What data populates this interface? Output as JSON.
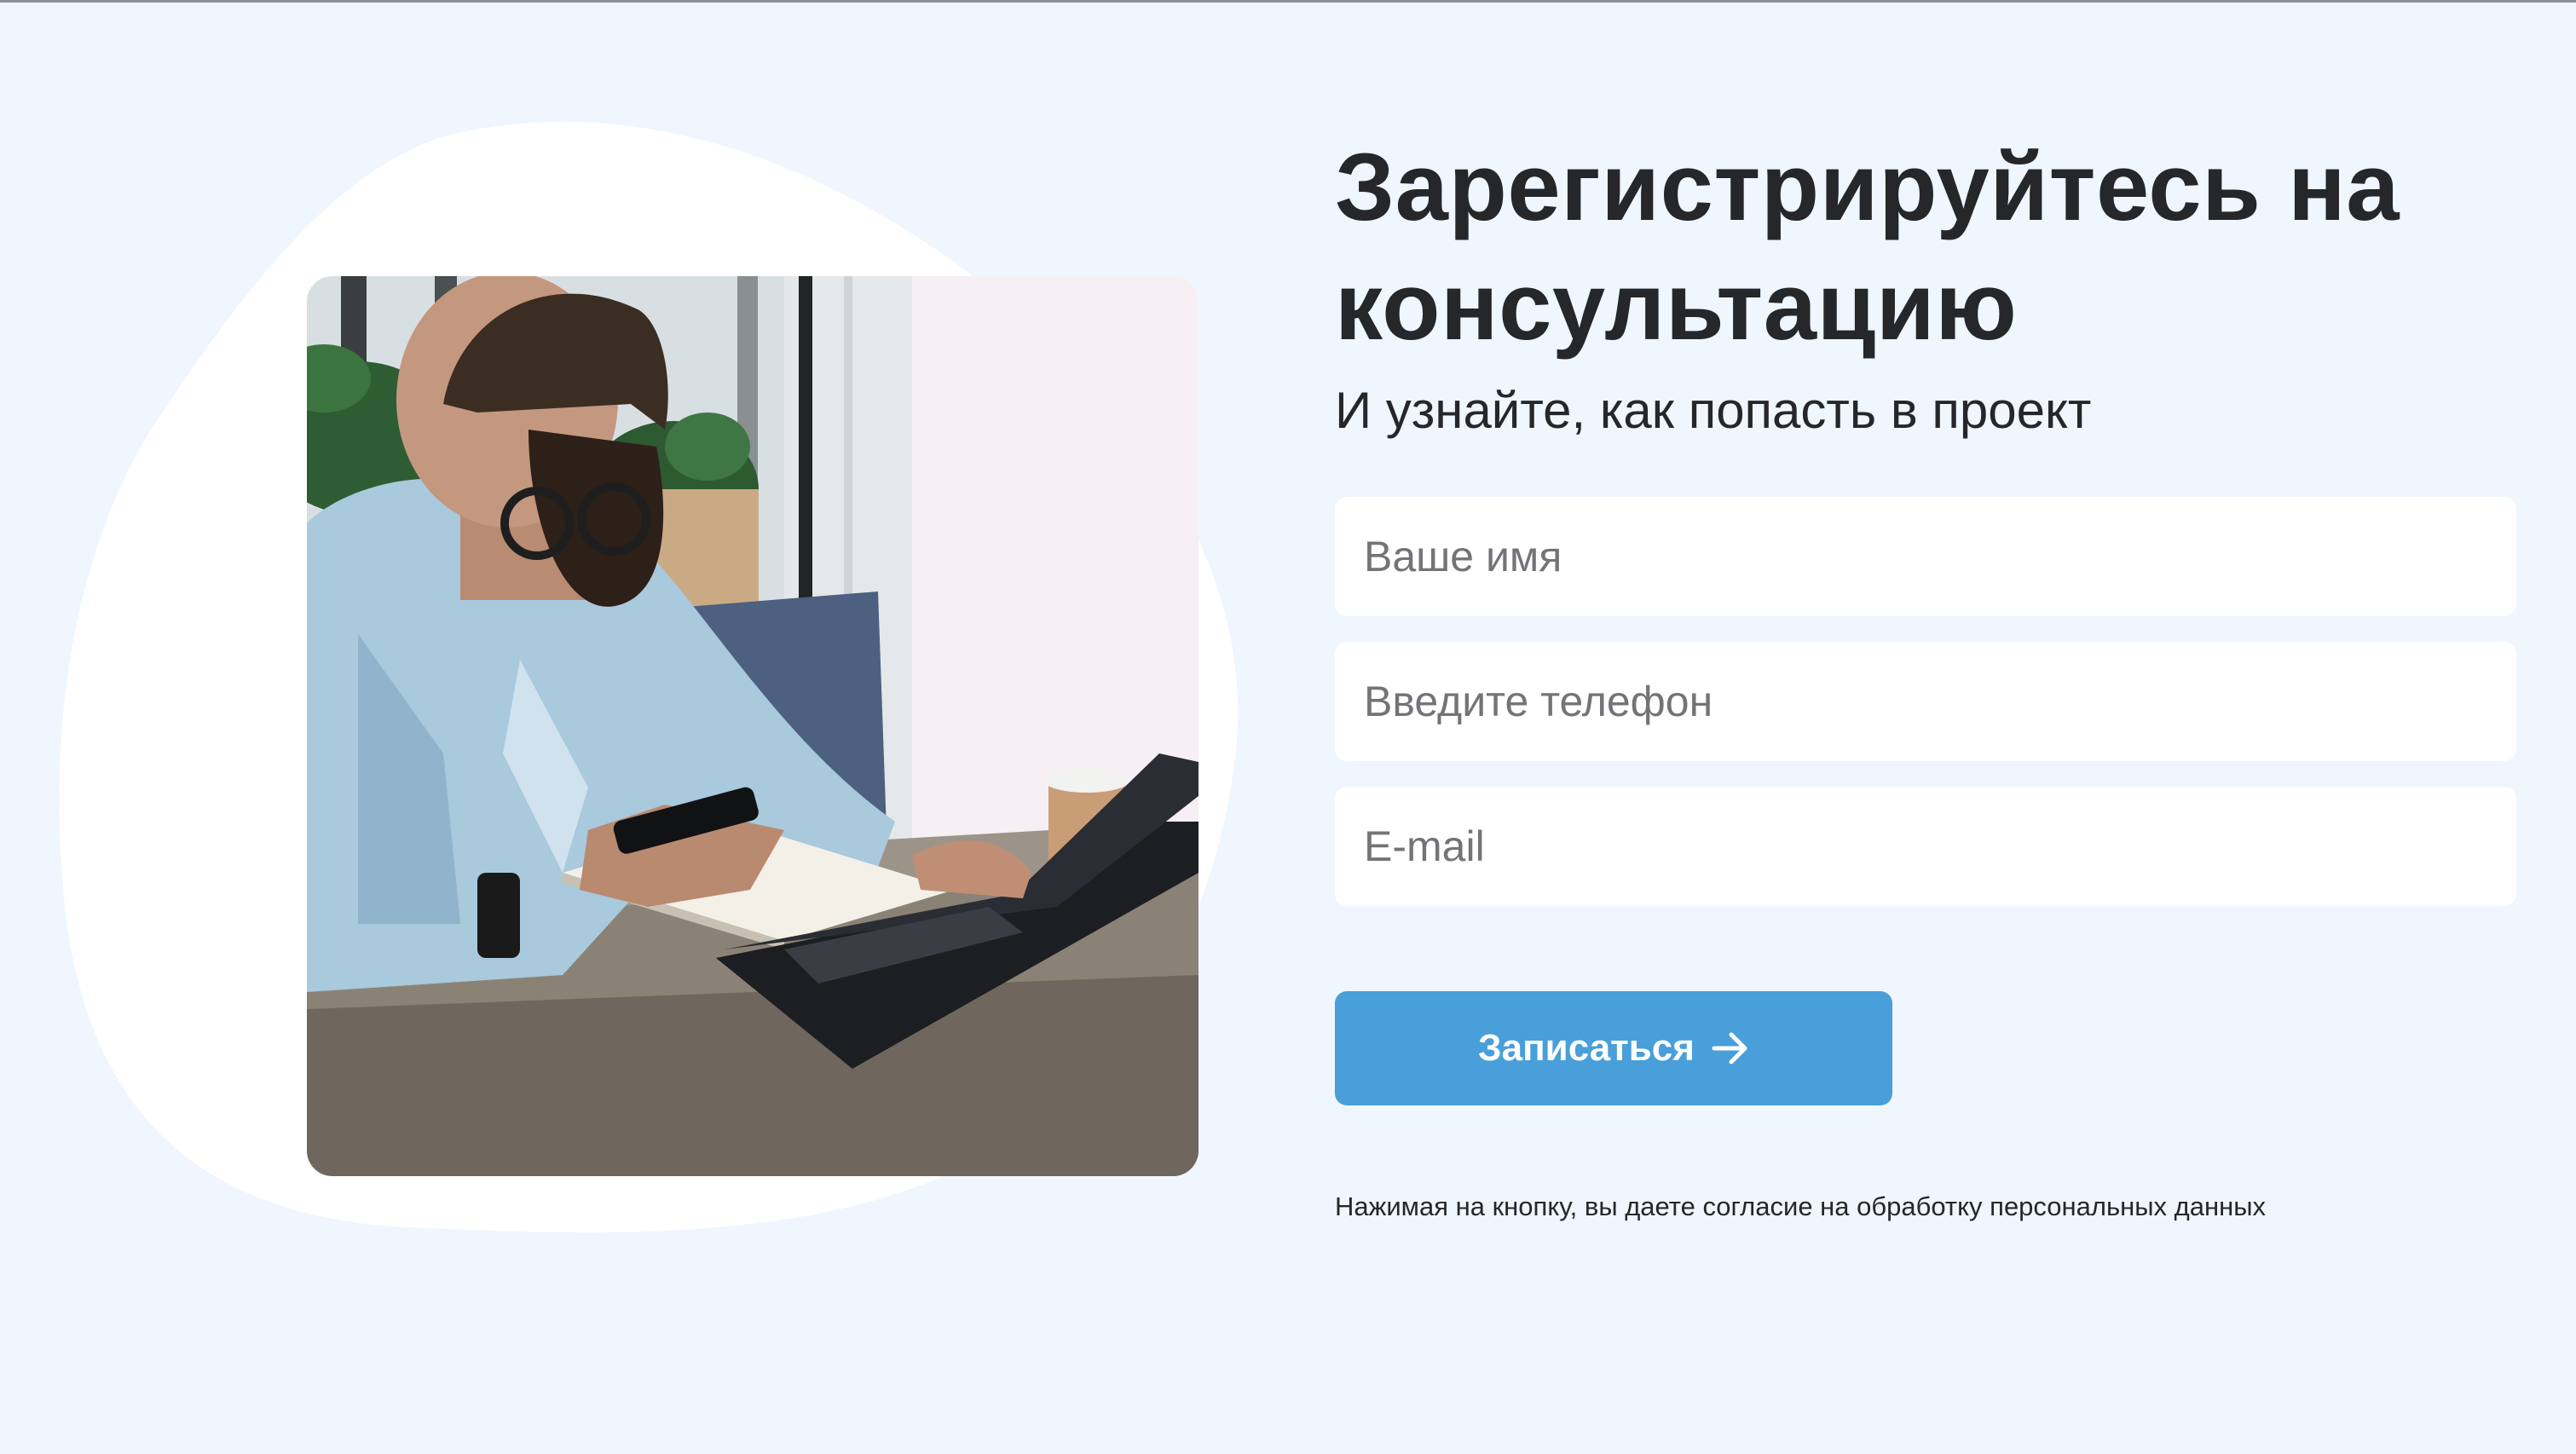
{
  "form": {
    "title": "Зарегистрируйтесь на консультацию",
    "subtitle": "И узнайте, как попасть в проект",
    "name_placeholder": "Ваше имя",
    "phone_placeholder": "Введите телефон",
    "email_placeholder": "E-mail",
    "submit_label": "Записаться",
    "submit_icon": "arrow-right-icon",
    "consent_text": "Нажимая на кнопку, вы даете согласие на обработку персональных данных"
  },
  "colors": {
    "background": "#eff6fd",
    "accent": "#489fd9",
    "text": "#25272a",
    "field_background": "#ffffff"
  }
}
